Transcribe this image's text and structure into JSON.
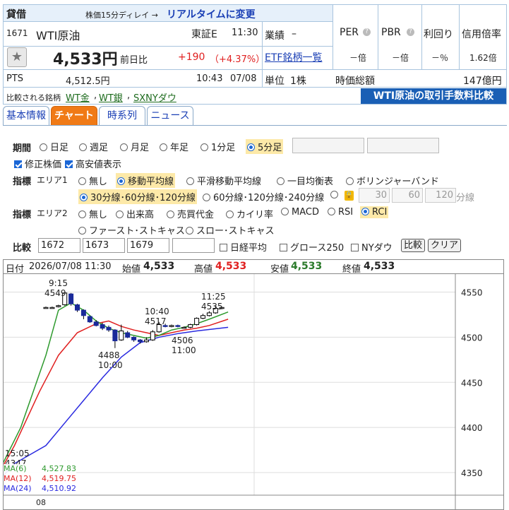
{
  "header": {
    "kind": "貸借",
    "delay_note": "株価15分ディレイ →",
    "realtime_link": "リアルタイムに変更"
  },
  "stock": {
    "code": "1671",
    "name": "WTI原油",
    "market": "東証E",
    "time": "11:30",
    "price": "4,533円",
    "change_label": "前日比",
    "change": "+190",
    "change_pct": "（+4.37%）",
    "pts_label": "PTS",
    "pts_price": "4,512.5円",
    "pts_time": "10:43",
    "pts_date": "07/08"
  },
  "gyoseki": {
    "label": "業績",
    "value": "–",
    "etf_link": "ETF銘柄一覧",
    "unit_label": "単位",
    "unit_value": "1株",
    "mcap_label": "時価総額",
    "mcap_value": "147億円"
  },
  "indicators": {
    "per_label": "PER",
    "per_value": "－倍",
    "pbr_label": "PBR",
    "pbr_value": "－倍",
    "yield_label": "利回り",
    "yield_value": "－％",
    "margin_label": "信用倍率",
    "margin_value": "1.62倍"
  },
  "compare": {
    "label": "比較される銘柄",
    "items": [
      "WT金",
      "WT銀",
      "SXNYダウ"
    ],
    "banner": "WTI原油の取引手数料比較"
  },
  "tabs": [
    "基本情報",
    "チャート",
    "時系列",
    "ニュース"
  ],
  "period": {
    "label": "期間",
    "options": [
      "日足",
      "週足",
      "月足",
      "年足",
      "1分足",
      "5分足"
    ],
    "selected": "5分足"
  },
  "options": {
    "adjusted": "修正株価",
    "highlow": "高安値表示"
  },
  "area1": {
    "label": "指標",
    "area_label": "エリア1",
    "options": [
      "無し",
      "移動平均線",
      "平滑移動平均線",
      "一目均衡表",
      "ボリンジャーバンド"
    ],
    "ma_options": [
      "30分線･60分線･120分線",
      "60分線･120分線･240分線"
    ],
    "custom_values": [
      "30",
      "60",
      "120"
    ],
    "custom_unit": "分線"
  },
  "area2": {
    "label": "指標",
    "area_label": "エリア2",
    "options": [
      "無し",
      "出来高",
      "売買代金",
      "カイリ率",
      "MACD",
      "RSI",
      "RCI",
      "ファースト･ストキャス",
      "スロー･ストキャス"
    ]
  },
  "compare_form": {
    "label": "比較",
    "codes": [
      "1672",
      "1673",
      "1679",
      ""
    ],
    "checks": [
      "日経平均",
      "グロース250",
      "NYダウ"
    ],
    "compare_btn": "比較",
    "clear_btn": "クリア"
  },
  "ohlc": {
    "date_label": "日付",
    "date": "2026/07/08 11:30",
    "open_label": "始値",
    "open": "4,533",
    "high_label": "高値",
    "high": "4,533",
    "low_label": "安値",
    "low": "4,533",
    "close_label": "終値",
    "close": "4,533"
  },
  "chart_annotations": {
    "hi_time": "9:15",
    "hi_price": "4549",
    "low_price": "4488",
    "low_time": "10:00",
    "mid_time": "10:40",
    "mid_price": "4517",
    "p2_price": "4506",
    "p2_time": "11:00",
    "last_time": "11:25",
    "last_price": "4535",
    "prev_time": "15:05",
    "prev_price": "4347",
    "xtick": "08"
  },
  "ma_legend": [
    {
      "name": "MA(6)",
      "value": "4,527.83",
      "color": "#2e9a2e"
    },
    {
      "name": "MA(12)",
      "value": "4,519.75",
      "color": "#e02020"
    },
    {
      "name": "MA(24)",
      "value": "4,510.92",
      "color": "#2a2ae0"
    }
  ],
  "colors": {
    "up": "#e02020",
    "down": "#2a7a2a",
    "accent": "#f07a16",
    "link": "#1a3fb5",
    "banner": "#1a5fb5"
  },
  "chart_data": {
    "type": "candlestick",
    "ylim": [
      4325,
      4570
    ],
    "yticks": [
      4350,
      4400,
      4450,
      4500,
      4550
    ],
    "candles": [
      {
        "t": 0,
        "o": 4533,
        "c": 4533,
        "h": 4534,
        "l": 4532
      },
      {
        "t": 1,
        "o": 4533,
        "c": 4533,
        "h": 4534,
        "l": 4532
      },
      {
        "t": 2,
        "o": 4534,
        "c": 4535,
        "h": 4536,
        "l": 4533
      },
      {
        "t": 3,
        "o": 4536,
        "c": 4549,
        "h": 4549,
        "l": 4535
      },
      {
        "t": 4,
        "o": 4548,
        "c": 4537,
        "h": 4549,
        "l": 4535
      },
      {
        "t": 5,
        "o": 4536,
        "c": 4530,
        "h": 4537,
        "l": 4528
      },
      {
        "t": 6,
        "o": 4530,
        "c": 4524,
        "h": 4531,
        "l": 4520
      },
      {
        "t": 7,
        "o": 4523,
        "c": 4517,
        "h": 4524,
        "l": 4516
      },
      {
        "t": 8,
        "o": 4517,
        "c": 4513,
        "h": 4519,
        "l": 4512
      },
      {
        "t": 9,
        "o": 4514,
        "c": 4510,
        "h": 4516,
        "l": 4508
      },
      {
        "t": 10,
        "o": 4511,
        "c": 4508,
        "h": 4513,
        "l": 4506
      },
      {
        "t": 11,
        "o": 4508,
        "c": 4496,
        "h": 4509,
        "l": 4488
      },
      {
        "t": 12,
        "o": 4497,
        "c": 4507,
        "h": 4514,
        "l": 4496
      },
      {
        "t": 13,
        "o": 4505,
        "c": 4500,
        "h": 4507,
        "l": 4499
      },
      {
        "t": 14,
        "o": 4500,
        "c": 4497,
        "h": 4501,
        "l": 4495
      },
      {
        "t": 15,
        "o": 4497,
        "c": 4495,
        "h": 4498,
        "l": 4493
      },
      {
        "t": 16,
        "o": 4495,
        "c": 4497,
        "h": 4500,
        "l": 4494
      },
      {
        "t": 17,
        "o": 4497,
        "c": 4506,
        "h": 4508,
        "l": 4496
      },
      {
        "t": 18,
        "o": 4506,
        "c": 4514,
        "h": 4517,
        "l": 4505
      },
      {
        "t": 19,
        "o": 4513,
        "c": 4512,
        "h": 4515,
        "l": 4511
      },
      {
        "t": 20,
        "o": 4512,
        "c": 4513,
        "h": 4514,
        "l": 4511
      },
      {
        "t": 21,
        "o": 4513,
        "c": 4512,
        "h": 4514,
        "l": 4511
      },
      {
        "t": 22,
        "o": 4511,
        "c": 4511,
        "h": 4512,
        "l": 4510
      },
      {
        "t": 23,
        "o": 4511,
        "c": 4514,
        "h": 4515,
        "l": 4510
      },
      {
        "t": 24,
        "o": 4514,
        "c": 4521,
        "h": 4522,
        "l": 4513
      },
      {
        "t": 25,
        "o": 4521,
        "c": 4524,
        "h": 4526,
        "l": 4520
      },
      {
        "t": 26,
        "o": 4524,
        "c": 4527,
        "h": 4529,
        "l": 4523
      },
      {
        "t": 27,
        "o": 4527,
        "c": 4532,
        "h": 4535,
        "l": 4526
      },
      {
        "t": 28,
        "o": 4532,
        "c": 4533,
        "h": 4534,
        "l": 4531
      }
    ],
    "ma6": [
      [
        -9,
        4330
      ],
      [
        -4,
        4400
      ],
      [
        0,
        4480
      ],
      [
        2,
        4530
      ],
      [
        4,
        4538
      ],
      [
        6,
        4530
      ],
      [
        8,
        4518
      ],
      [
        10,
        4510
      ],
      [
        12,
        4505
      ],
      [
        14,
        4502
      ],
      [
        16,
        4499
      ],
      [
        18,
        4502
      ],
      [
        20,
        4508
      ],
      [
        22,
        4511
      ],
      [
        24,
        4515
      ],
      [
        26,
        4520
      ],
      [
        29,
        4528
      ]
    ],
    "ma12": [
      [
        -9,
        4330
      ],
      [
        -5,
        4380
      ],
      [
        -1,
        4440
      ],
      [
        2,
        4480
      ],
      [
        5,
        4505
      ],
      [
        8,
        4515
      ],
      [
        10,
        4518
      ],
      [
        12,
        4512
      ],
      [
        14,
        4508
      ],
      [
        16,
        4505
      ],
      [
        18,
        4502
      ],
      [
        20,
        4505
      ],
      [
        22,
        4508
      ],
      [
        24,
        4510
      ],
      [
        26,
        4513
      ],
      [
        29,
        4520
      ]
    ],
    "ma24": [
      [
        -9,
        4330
      ],
      [
        -5,
        4360
      ],
      [
        0,
        4380
      ],
      [
        3,
        4405
      ],
      [
        6,
        4430
      ],
      [
        9,
        4455
      ],
      [
        12,
        4478
      ],
      [
        15,
        4494
      ],
      [
        18,
        4500
      ],
      [
        21,
        4504
      ],
      [
        24,
        4507
      ],
      [
        29,
        4511
      ]
    ]
  }
}
